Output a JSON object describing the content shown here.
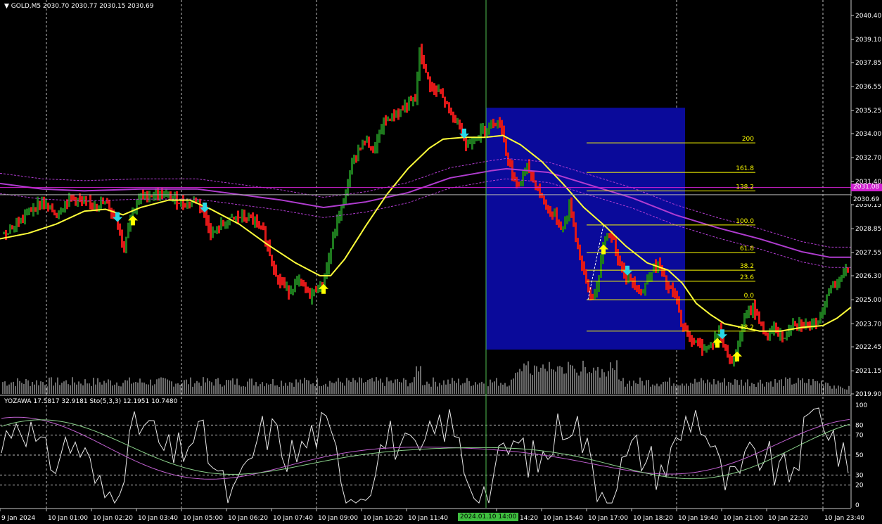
{
  "header": {
    "symbol_label": "GOLD,M5",
    "ohlc_label": "2030.70 2030.77 2030.15 2030.69"
  },
  "indicator_header": {
    "label": "YOZAWA 17.5817 32.9181  Sto(5,3,3) 12.1951 10.7480"
  },
  "price_tags": {
    "pink": "2031.08",
    "current": "2030.69"
  },
  "time_cursor_label": "2024.01.10 14:00",
  "colors": {
    "background": "#000000",
    "up_bar": "#1e7a1e",
    "down_bar": "#e01818",
    "yellow_ma": "#ffff3a",
    "purple_ma": "#b03cd0",
    "fib_line": "#ffff00",
    "box": "#0a0a9a",
    "cursor": "#4fbf4f",
    "arrow_up": "#ffff00",
    "arrow_down": "#29d6e6"
  },
  "chart_data": [
    {
      "type": "candlestick",
      "title": "GOLD,M5",
      "y_ticks": [
        "2040.40",
        "2039.10",
        "2037.85",
        "2036.55",
        "2035.25",
        "2034.00",
        "2032.70",
        "2031.40",
        "2030.15",
        "2028.85",
        "2027.55",
        "2026.30",
        "2025.00",
        "2023.70",
        "2022.45",
        "2021.15",
        "2019.90"
      ],
      "ylim": [
        2019.9,
        2040.4
      ],
      "x_ticks": [
        "9 Jan 2024",
        "10 Jan 01:00",
        "10 Jan 02:20",
        "10 Jan 03:40",
        "10 Jan 05:00",
        "10 Jan 06:20",
        "10 Jan 07:40",
        "10 Jan 09:00",
        "10 Jan 10:20",
        "10 Jan 11:40",
        "10 Jan 14:20",
        "10 Jan 15:40",
        "10 Jan 17:00",
        "10 Jan 18:20",
        "10 Jan 19:40",
        "10 Jan 21:00",
        "10 Jan 22:20",
        "10 Jan 23:40"
      ],
      "close_path": [
        [
          0,
          2028.5
        ],
        [
          20,
          2029.0
        ],
        [
          40,
          2029.8
        ],
        [
          60,
          2030.3
        ],
        [
          80,
          2029.6
        ],
        [
          100,
          2030.6
        ],
        [
          120,
          2030.2
        ],
        [
          150,
          2030.2
        ],
        [
          165,
          2029.4
        ],
        [
          175,
          2027.7
        ],
        [
          185,
          2029.6
        ],
        [
          200,
          2030.6
        ],
        [
          220,
          2030.7
        ],
        [
          240,
          2030.6
        ],
        [
          260,
          2030.2
        ],
        [
          280,
          2030.4
        ],
        [
          290,
          2029.7
        ],
        [
          300,
          2028.5
        ],
        [
          320,
          2029.2
        ],
        [
          340,
          2029.5
        ],
        [
          360,
          2029.3
        ],
        [
          375,
          2028.6
        ],
        [
          385,
          2027.2
        ],
        [
          395,
          2026.1
        ],
        [
          410,
          2025.5
        ],
        [
          425,
          2026.0
        ],
        [
          440,
          2025.2
        ],
        [
          455,
          2025.8
        ],
        [
          462,
          2026.3
        ],
        [
          470,
          2027.8
        ],
        [
          480,
          2029.4
        ],
        [
          490,
          2030.6
        ],
        [
          500,
          2032.4
        ],
        [
          510,
          2033.2
        ],
        [
          520,
          2033.7
        ],
        [
          530,
          2033.0
        ],
        [
          545,
          2034.6
        ],
        [
          560,
          2035.0
        ],
        [
          580,
          2035.6
        ],
        [
          590,
          2035.8
        ],
        [
          596,
          2038.5
        ],
        [
          605,
          2037.2
        ],
        [
          615,
          2036.4
        ],
        [
          625,
          2036.2
        ],
        [
          640,
          2035.1
        ],
        [
          655,
          2034.3
        ],
        [
          662,
          2033.3
        ],
        [
          675,
          2033.8
        ],
        [
          690,
          2034.3
        ],
        [
          700,
          2034.7
        ],
        [
          712,
          2034.5
        ],
        [
          720,
          2032.8
        ],
        [
          735,
          2031.0
        ],
        [
          748,
          2032.2
        ],
        [
          760,
          2031.3
        ],
        [
          775,
          2030.1
        ],
        [
          790,
          2029.4
        ],
        [
          800,
          2028.8
        ],
        [
          810,
          2030.2
        ],
        [
          820,
          2028.0
        ],
        [
          830,
          2026.4
        ],
        [
          840,
          2025.0
        ],
        [
          850,
          2025.8
        ],
        [
          858,
          2028.3
        ],
        [
          868,
          2028.6
        ],
        [
          878,
          2027.3
        ],
        [
          890,
          2026.2
        ],
        [
          900,
          2026.0
        ],
        [
          912,
          2025.3
        ],
        [
          925,
          2026.6
        ],
        [
          937,
          2026.9
        ],
        [
          948,
          2025.7
        ],
        [
          960,
          2025.2
        ],
        [
          970,
          2023.4
        ],
        [
          980,
          2023.0
        ],
        [
          992,
          2022.5
        ],
        [
          1002,
          2022.4
        ],
        [
          1012,
          2022.6
        ],
        [
          1022,
          2023.4
        ],
        [
          1030,
          2022.3
        ],
        [
          1040,
          2021.6
        ],
        [
          1048,
          2022.5
        ],
        [
          1058,
          2023.9
        ],
        [
          1070,
          2024.6
        ],
        [
          1080,
          2023.8
        ],
        [
          1090,
          2022.9
        ],
        [
          1100,
          2023.5
        ],
        [
          1115,
          2022.8
        ],
        [
          1125,
          2023.8
        ],
        [
          1140,
          2023.7
        ],
        [
          1160,
          2023.5
        ],
        [
          1170,
          2024.6
        ],
        [
          1180,
          2025.7
        ],
        [
          1195,
          2026.2
        ],
        [
          1205,
          2026.6
        ],
        [
          1209,
          2027.5
        ]
      ],
      "yellow_ma": [
        [
          0,
          2028.3
        ],
        [
          40,
          2028.6
        ],
        [
          80,
          2029.1
        ],
        [
          120,
          2029.8
        ],
        [
          150,
          2029.9
        ],
        [
          175,
          2029.6
        ],
        [
          200,
          2030.0
        ],
        [
          240,
          2030.4
        ],
        [
          270,
          2030.4
        ],
        [
          300,
          2029.9
        ],
        [
          340,
          2029.1
        ],
        [
          380,
          2028.0
        ],
        [
          420,
          2027.0
        ],
        [
          455,
          2026.3
        ],
        [
          470,
          2026.3
        ],
        [
          490,
          2027.2
        ],
        [
          520,
          2029.0
        ],
        [
          550,
          2030.7
        ],
        [
          580,
          2032.1
        ],
        [
          610,
          2033.2
        ],
        [
          630,
          2033.7
        ],
        [
          660,
          2033.8
        ],
        [
          690,
          2033.8
        ],
        [
          715,
          2033.9
        ],
        [
          740,
          2033.4
        ],
        [
          770,
          2032.5
        ],
        [
          800,
          2031.3
        ],
        [
          830,
          2030.0
        ],
        [
          860,
          2029.0
        ],
        [
          890,
          2027.9
        ],
        [
          920,
          2027.0
        ],
        [
          950,
          2026.6
        ],
        [
          970,
          2025.9
        ],
        [
          990,
          2024.8
        ],
        [
          1010,
          2024.2
        ],
        [
          1030,
          2023.7
        ],
        [
          1055,
          2023.5
        ],
        [
          1080,
          2023.3
        ],
        [
          1110,
          2023.3
        ],
        [
          1140,
          2023.5
        ],
        [
          1170,
          2023.6
        ],
        [
          1190,
          2024.0
        ],
        [
          1210,
          2024.6
        ]
      ],
      "purple_ma": [
        [
          0,
          2031.3
        ],
        [
          60,
          2031.0
        ],
        [
          120,
          2030.9
        ],
        [
          200,
          2031.0
        ],
        [
          280,
          2031.0
        ],
        [
          340,
          2030.7
        ],
        [
          400,
          2030.4
        ],
        [
          460,
          2030.0
        ],
        [
          520,
          2030.3
        ],
        [
          580,
          2030.8
        ],
        [
          640,
          2031.6
        ],
        [
          700,
          2032.0
        ],
        [
          720,
          2032.1
        ],
        [
          780,
          2031.9
        ],
        [
          840,
          2031.2
        ],
        [
          900,
          2030.5
        ],
        [
          960,
          2029.6
        ],
        [
          1020,
          2028.9
        ],
        [
          1080,
          2028.3
        ],
        [
          1140,
          2027.6
        ],
        [
          1180,
          2027.3
        ],
        [
          1210,
          2027.3
        ]
      ],
      "annotations": {
        "fibonacci_levels": [
          "200",
          "161.8",
          "138.2",
          "100.0",
          "61.8",
          "38.2",
          "23.6",
          "0.0",
          "-38.2"
        ],
        "fibonacci_prices": [
          2033.5,
          2031.9,
          2030.9,
          2029.05,
          2027.55,
          2026.6,
          2026.0,
          2025.0,
          2023.3
        ],
        "box_price_range": [
          2022.3,
          2035.4
        ],
        "horizontal_lines": [
          2031.08,
          2030.69
        ],
        "arrows_up_x": [
          189,
          460,
          858,
          1020,
          1048
        ],
        "arrows_down_x": [
          167,
          291,
          660,
          892,
          1027
        ]
      }
    },
    {
      "type": "line",
      "title": "YOZAWA 17.5817 32.9181  Sto(5,3,3) 12.1951 10.7480",
      "y_ticks": [
        "100",
        "80",
        "70",
        "50",
        "30",
        "20",
        "0"
      ],
      "ylim": [
        0,
        100
      ],
      "levels": [
        80,
        70,
        50,
        30,
        20
      ]
    }
  ]
}
